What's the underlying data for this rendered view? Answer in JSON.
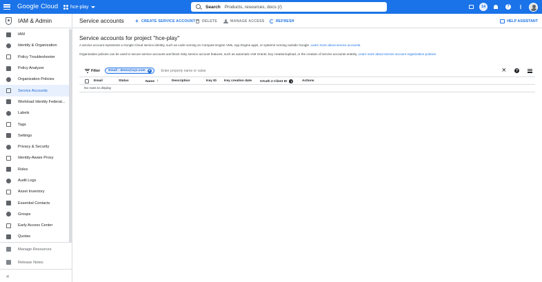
{
  "topbar": {
    "logo_text": "Google Cloud",
    "project": "hce-play",
    "search_label": "Search",
    "search_hint": "Products, resources, docs (/)",
    "notification_count": "14",
    "brand_color": "#1a73e8"
  },
  "sidebar": {
    "title": "IAM & Admin",
    "items": [
      {
        "label": "IAM",
        "icon": "person-add-icon"
      },
      {
        "label": "Identity & Organization",
        "icon": "identity-icon"
      },
      {
        "label": "Policy Troubleshooter",
        "icon": "wrench-icon"
      },
      {
        "label": "Policy Analyzer",
        "icon": "analyzer-icon"
      },
      {
        "label": "Organization Policies",
        "icon": "policy-doc-icon"
      },
      {
        "label": "Service Accounts",
        "icon": "service-account-icon",
        "active": true
      },
      {
        "label": "Workload Identity Federat...",
        "icon": "workload-identity-icon"
      },
      {
        "label": "Labels",
        "icon": "label-icon"
      },
      {
        "label": "Tags",
        "icon": "tag-icon"
      },
      {
        "label": "Settings",
        "icon": "gear-icon"
      },
      {
        "label": "Privacy & Security",
        "icon": "lock-icon"
      },
      {
        "label": "Identity-Aware Proxy",
        "icon": "proxy-icon"
      },
      {
        "label": "Roles",
        "icon": "roles-icon"
      },
      {
        "label": "Audit Logs",
        "icon": "audit-icon"
      },
      {
        "label": "Asset Inventory",
        "icon": "inventory-icon"
      },
      {
        "label": "Essential Contacts",
        "icon": "contacts-icon"
      },
      {
        "label": "Groups",
        "icon": "groups-icon"
      },
      {
        "label": "Early Access Center",
        "icon": "early-access-icon"
      },
      {
        "label": "Quotas",
        "icon": "quotas-icon"
      }
    ],
    "bottom": {
      "manage_resources": "Manage Resources",
      "release_notes": "Release Notes"
    },
    "collapse_glyph": "«"
  },
  "toolbar": {
    "page_title": "Service accounts",
    "create": "CREATE SERVICE ACCOUNT",
    "delete": "DELETE",
    "manage_access": "MANAGE ACCESS",
    "refresh": "REFRESH",
    "help": "HELP ASSISTANT"
  },
  "content": {
    "title": "Service accounts for project \"hce-play\"",
    "desc1": "A service account represents a Google Cloud service identity, such as code running on Compute Engine VMs, App Engine apps, or systems running outside Google.",
    "desc1_link": "Learn more about service accounts.",
    "desc2": "Organization policies can be used to secure service accounts and block risky service account features, such as automatic IAM Grants, key creation/upload, or the creation of service accounts entirely.",
    "desc2_link": "Learn more about service account organization policies."
  },
  "filter": {
    "label": "Filter",
    "chip": "Email : demo@xyz.com",
    "placeholder": "Enter property name or value"
  },
  "table": {
    "columns": [
      "Email",
      "Status",
      "Name",
      "Description",
      "Key ID",
      "Key creation date",
      "OAuth 2 Client ID",
      "Actions"
    ],
    "sorted_by": "Name",
    "empty_text": "No rows to display"
  }
}
